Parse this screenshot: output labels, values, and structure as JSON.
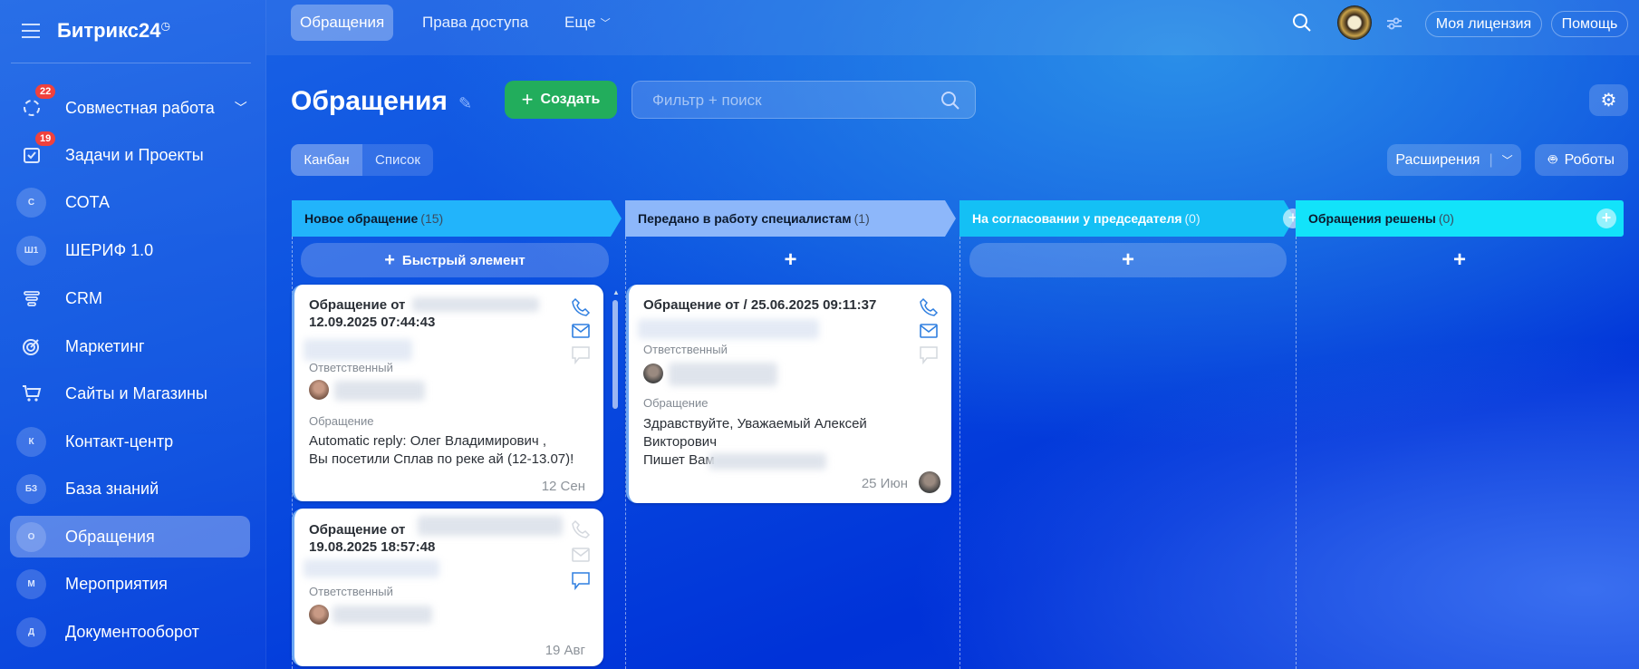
{
  "app": {
    "logo": "Битрикс24",
    "logo_mark": "◷"
  },
  "sidebar": {
    "items": [
      {
        "label": "Совместная работа",
        "icon": "collab",
        "badge": "22"
      },
      {
        "label": "Задачи и Проекты",
        "icon": "tasks",
        "badge": "19"
      },
      {
        "label": "СОТА",
        "icon": "С"
      },
      {
        "label": "ШЕРИФ 1.0",
        "icon": "Ш1"
      },
      {
        "label": "CRM",
        "icon": "crm-funnel"
      },
      {
        "label": "Маркетинг",
        "icon": "target"
      },
      {
        "label": "Сайты и Магазины",
        "icon": "cart"
      },
      {
        "label": "Контакт-центр",
        "icon": "К"
      },
      {
        "label": "База знаний",
        "icon": "БЗ"
      },
      {
        "label": "Обращения",
        "icon": "О",
        "active": true
      },
      {
        "label": "Мероприятия",
        "icon": "М"
      },
      {
        "label": "Документооборот",
        "icon": "Д"
      }
    ]
  },
  "topbar": {
    "tabs": [
      "Обращения",
      "Права доступа",
      "Еще"
    ],
    "license": "Моя лицензия",
    "help": "Помощь"
  },
  "page": {
    "title": "Обращения",
    "create": "Создать",
    "filter_placeholder": "Фильтр + поиск",
    "views": [
      "Канбан",
      "Список"
    ],
    "extensions": "Расширения",
    "robots": "Роботы",
    "quick_item": "Быстрый элемент"
  },
  "columns": [
    {
      "title": "Новое обращение",
      "count": "(15)",
      "color": "#22b4fb"
    },
    {
      "title": "Передано в работу специалистам",
      "count": "(1)",
      "color": "#8db7fa"
    },
    {
      "title": "На согласовании у председателя",
      "count": "(0)",
      "color": "#14c0f5"
    },
    {
      "title": "Обращения решены",
      "count": "(0)",
      "color": "#12e3fa"
    }
  ],
  "cards": [
    {
      "title1": "Обращение от",
      "title2": "12.09.2025 07:44:43",
      "resp_label": "Ответственный",
      "subject_label": "Обращение",
      "text1": "Automatic reply: Олег Владимирович ,",
      "text2": "Вы посетили Сплав по реке ай (12-13.07)!",
      "date": "12 Сен"
    },
    {
      "title1": "Обращение от / 25.06.2025 09:11:37",
      "resp_label": "Ответственный",
      "subject_label": "Обращение",
      "text1": "Здравствуйте, Уважаемый Алексей",
      "text2": "Викторович",
      "text3": "Пишет Вам",
      "date": "25 Июн"
    },
    {
      "title1": "Обращение от",
      "title2": "19.08.2025 18:57:48",
      "resp_label": "Ответственный",
      "date": "19 Авг"
    }
  ]
}
